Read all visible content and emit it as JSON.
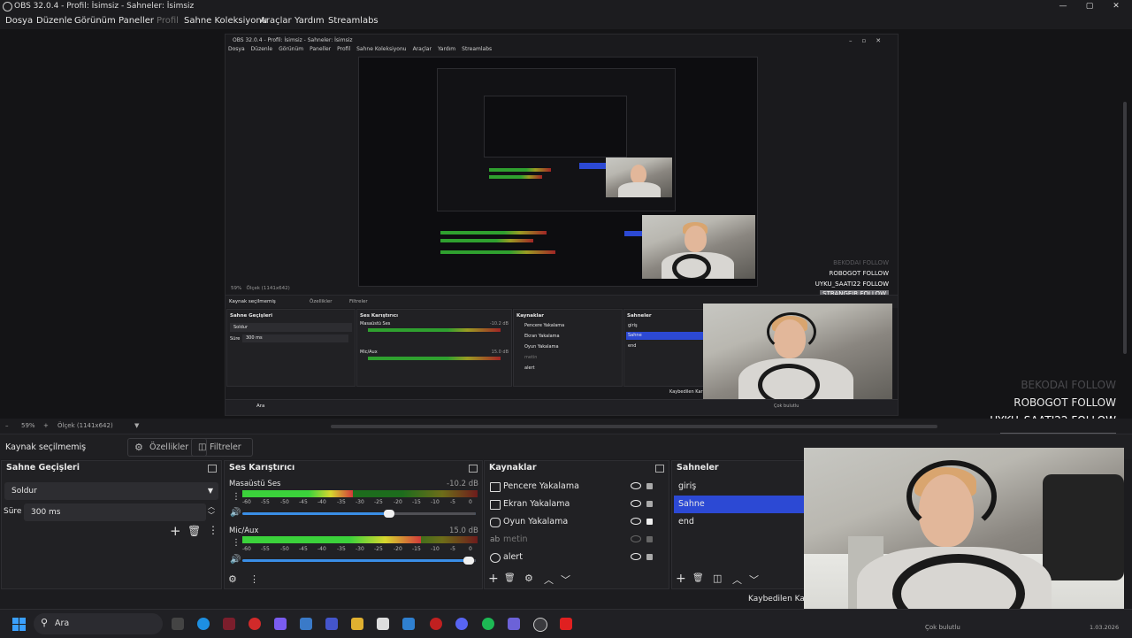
{
  "window": {
    "title": "OBS 32.0.4 - Profil: İsimsiz - Sahneler: İsimsiz",
    "controls": [
      "—",
      "▢",
      "✕"
    ]
  },
  "menu": {
    "items": [
      "Dosya",
      "Düzenle",
      "Görünüm",
      "Paneller",
      "Profil",
      "Sahne Koleksiyonu",
      "Araçlar",
      "Yardım",
      "Streamlabs"
    ]
  },
  "nested": {
    "title": "OBS 32.0.4 - Profil: İsimsiz - Sahneler: İsimsiz",
    "menu": [
      "Dosya",
      "Düzenle",
      "Görünüm",
      "Paneller",
      "Profil",
      "Sahne Koleksiyonu",
      "Araçlar",
      "Yardım",
      "Streamlabs"
    ],
    "zoom": "59%",
    "scale": "Ölçek (1141x642)",
    "context": "Kaynak seçilmemiş",
    "props": "Özellikler",
    "filters": "Filtreler",
    "transitions_title": "Sahne Geçişleri",
    "transition": "Soldur",
    "duration_label": "Süre",
    "duration": "300 ms",
    "mixer_title": "Ses Karıştırıcı",
    "desktop_audio": "Masaüstü Ses",
    "mic": "Mic/Aux",
    "db1": "-10.2 dB",
    "db2": "15.0 dB",
    "sources_title": "Kaynaklar",
    "sources": [
      "Pencere Yakalama",
      "Ekran Yakalama",
      "Oyun Yakalama",
      "metin",
      "alert"
    ],
    "scenes_title": "Sahneler",
    "scenes": [
      "giriş",
      "Sahne",
      "end"
    ],
    "status": "Kaybedilen Kar",
    "search": "Ara",
    "weather": "Çok bulutlu"
  },
  "alerts": [
    {
      "name": "BEKODAI",
      "action": "FOLLOW"
    },
    {
      "name": "ROBOGOT",
      "action": "FOLLOW"
    },
    {
      "name": "UYKU_SAATI22",
      "action": "FOLLOW"
    },
    {
      "name": "STRANGEJR",
      "action": "FOLLOW"
    }
  ],
  "zoombar": {
    "zoom": "59%",
    "scale": "Ölçek (1141x642)"
  },
  "context_bar": {
    "no_source": "Kaynak seçilmemiş",
    "properties": "Özellikler",
    "filters": "Filtreler"
  },
  "transitions": {
    "title": "Sahne Geçişleri",
    "transition_value": "Soldur",
    "duration_label": "Süre",
    "duration_value": "300 ms"
  },
  "mixer": {
    "title": "Ses Karıştırıcı",
    "ticks": [
      "-60",
      "-55",
      "-50",
      "-45",
      "-40",
      "-35",
      "-30",
      "-25",
      "-20",
      "-15",
      "-10",
      "-5",
      "0"
    ],
    "channels": [
      {
        "name": "Masaüstü Ses",
        "db": "-10.2 dB",
        "level": 0.47,
        "volume": 0.63
      },
      {
        "name": "Mic/Aux",
        "db": "15.0 dB",
        "level": 0.76,
        "volume": 0.97
      }
    ]
  },
  "sources": {
    "title": "Kaynaklar",
    "items": [
      {
        "label": "Pencere Yakalama",
        "icon": "window-icon",
        "visible": true
      },
      {
        "label": "Ekran Yakalama",
        "icon": "monitor-icon",
        "visible": true
      },
      {
        "label": "Oyun Yakalama",
        "icon": "gamepad-icon",
        "visible": true
      },
      {
        "label": "metin",
        "icon": "text-icon",
        "visible": false
      },
      {
        "label": "alert",
        "icon": "globe-icon",
        "visible": true
      }
    ]
  },
  "scenes": {
    "title": "Sahneler",
    "items": [
      "giriş",
      "Sahne",
      "end"
    ],
    "selected": 1
  },
  "status": {
    "dropped_frames": "Kaybedilen Kar"
  },
  "taskbar": {
    "search": "Ara",
    "weather": "Çok bulutlu",
    "date": "1.03.2026"
  },
  "colors": {
    "accent": "#2c49d4",
    "meter_green": "#3bd23b",
    "meter_yellow": "#d7d72f",
    "meter_red": "#d23a3a"
  }
}
